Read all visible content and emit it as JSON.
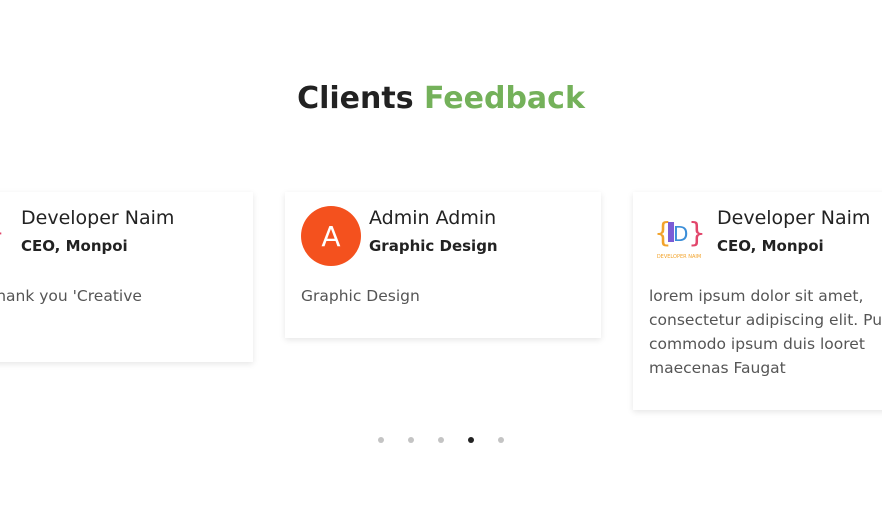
{
  "heading": {
    "main": "Clients",
    "accent": "Feedback"
  },
  "colors": {
    "accent": "#74b15a",
    "avatar_bg": "#f4511e"
  },
  "cards": [
    {
      "name": "Developer Naim",
      "role": "CEO, Monpoi",
      "avatar_type": "logo-icon",
      "text": "Job. Thank you 'Creative\ncy'"
    },
    {
      "name": "Admin Admin",
      "role": "Graphic Design",
      "avatar_type": "letter",
      "avatar_letter": "A",
      "text": "Graphic Design"
    },
    {
      "name": "Developer Naim",
      "role": "CEO, Monpoi",
      "avatar_type": "logo-icon",
      "logo_caption": "DEVELOPER NAIM",
      "text": "lorem ipsum dolor sit amet,\nconsectetur adipiscing elit. Pu\ncommodo ipsum duis looret\nmaecenas Faugat"
    }
  ],
  "pagination": {
    "total": 5,
    "active_index": 3
  }
}
